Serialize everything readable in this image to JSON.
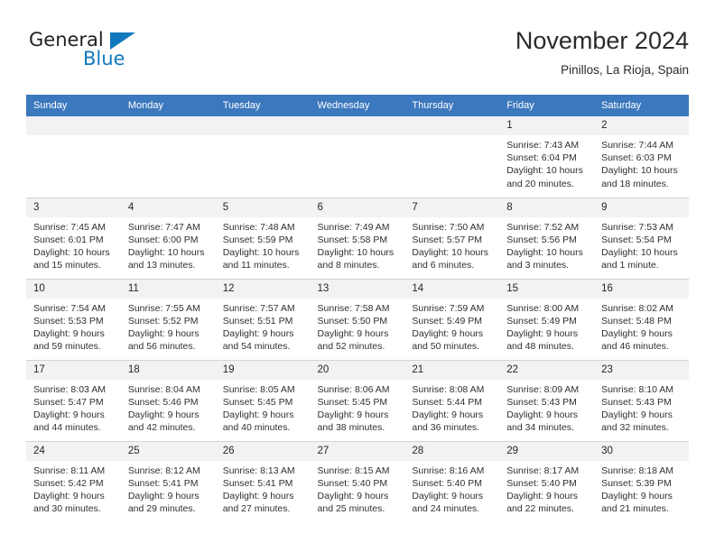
{
  "brand": {
    "name_top": "General",
    "name_bottom": "Blue",
    "triangle_color": "#1278be"
  },
  "header": {
    "month_title": "November 2024",
    "location": "Pinillos, La Rioja, Spain",
    "header_bg": "#3c78bd",
    "daynum_bg": "#f2f2f2"
  },
  "weekday_headers": [
    "Sunday",
    "Monday",
    "Tuesday",
    "Wednesday",
    "Thursday",
    "Friday",
    "Saturday"
  ],
  "labels": {
    "sunrise_prefix": "Sunrise:",
    "sunset_prefix": "Sunset:",
    "daylight_prefix": "Daylight:"
  },
  "weeks": [
    [
      {
        "day": "",
        "empty": true
      },
      {
        "day": "",
        "empty": true
      },
      {
        "day": "",
        "empty": true
      },
      {
        "day": "",
        "empty": true
      },
      {
        "day": "",
        "empty": true
      },
      {
        "day": "1",
        "sunrise": "Sunrise: 7:43 AM",
        "sunset": "Sunset: 6:04 PM",
        "daylight": "Daylight: 10 hours and 20 minutes."
      },
      {
        "day": "2",
        "sunrise": "Sunrise: 7:44 AM",
        "sunset": "Sunset: 6:03 PM",
        "daylight": "Daylight: 10 hours and 18 minutes."
      }
    ],
    [
      {
        "day": "3",
        "sunrise": "Sunrise: 7:45 AM",
        "sunset": "Sunset: 6:01 PM",
        "daylight": "Daylight: 10 hours and 15 minutes."
      },
      {
        "day": "4",
        "sunrise": "Sunrise: 7:47 AM",
        "sunset": "Sunset: 6:00 PM",
        "daylight": "Daylight: 10 hours and 13 minutes."
      },
      {
        "day": "5",
        "sunrise": "Sunrise: 7:48 AM",
        "sunset": "Sunset: 5:59 PM",
        "daylight": "Daylight: 10 hours and 11 minutes."
      },
      {
        "day": "6",
        "sunrise": "Sunrise: 7:49 AM",
        "sunset": "Sunset: 5:58 PM",
        "daylight": "Daylight: 10 hours and 8 minutes."
      },
      {
        "day": "7",
        "sunrise": "Sunrise: 7:50 AM",
        "sunset": "Sunset: 5:57 PM",
        "daylight": "Daylight: 10 hours and 6 minutes."
      },
      {
        "day": "8",
        "sunrise": "Sunrise: 7:52 AM",
        "sunset": "Sunset: 5:56 PM",
        "daylight": "Daylight: 10 hours and 3 minutes."
      },
      {
        "day": "9",
        "sunrise": "Sunrise: 7:53 AM",
        "sunset": "Sunset: 5:54 PM",
        "daylight": "Daylight: 10 hours and 1 minute."
      }
    ],
    [
      {
        "day": "10",
        "sunrise": "Sunrise: 7:54 AM",
        "sunset": "Sunset: 5:53 PM",
        "daylight": "Daylight: 9 hours and 59 minutes."
      },
      {
        "day": "11",
        "sunrise": "Sunrise: 7:55 AM",
        "sunset": "Sunset: 5:52 PM",
        "daylight": "Daylight: 9 hours and 56 minutes."
      },
      {
        "day": "12",
        "sunrise": "Sunrise: 7:57 AM",
        "sunset": "Sunset: 5:51 PM",
        "daylight": "Daylight: 9 hours and 54 minutes."
      },
      {
        "day": "13",
        "sunrise": "Sunrise: 7:58 AM",
        "sunset": "Sunset: 5:50 PM",
        "daylight": "Daylight: 9 hours and 52 minutes."
      },
      {
        "day": "14",
        "sunrise": "Sunrise: 7:59 AM",
        "sunset": "Sunset: 5:49 PM",
        "daylight": "Daylight: 9 hours and 50 minutes."
      },
      {
        "day": "15",
        "sunrise": "Sunrise: 8:00 AM",
        "sunset": "Sunset: 5:49 PM",
        "daylight": "Daylight: 9 hours and 48 minutes."
      },
      {
        "day": "16",
        "sunrise": "Sunrise: 8:02 AM",
        "sunset": "Sunset: 5:48 PM",
        "daylight": "Daylight: 9 hours and 46 minutes."
      }
    ],
    [
      {
        "day": "17",
        "sunrise": "Sunrise: 8:03 AM",
        "sunset": "Sunset: 5:47 PM",
        "daylight": "Daylight: 9 hours and 44 minutes."
      },
      {
        "day": "18",
        "sunrise": "Sunrise: 8:04 AM",
        "sunset": "Sunset: 5:46 PM",
        "daylight": "Daylight: 9 hours and 42 minutes."
      },
      {
        "day": "19",
        "sunrise": "Sunrise: 8:05 AM",
        "sunset": "Sunset: 5:45 PM",
        "daylight": "Daylight: 9 hours and 40 minutes."
      },
      {
        "day": "20",
        "sunrise": "Sunrise: 8:06 AM",
        "sunset": "Sunset: 5:45 PM",
        "daylight": "Daylight: 9 hours and 38 minutes."
      },
      {
        "day": "21",
        "sunrise": "Sunrise: 8:08 AM",
        "sunset": "Sunset: 5:44 PM",
        "daylight": "Daylight: 9 hours and 36 minutes."
      },
      {
        "day": "22",
        "sunrise": "Sunrise: 8:09 AM",
        "sunset": "Sunset: 5:43 PM",
        "daylight": "Daylight: 9 hours and 34 minutes."
      },
      {
        "day": "23",
        "sunrise": "Sunrise: 8:10 AM",
        "sunset": "Sunset: 5:43 PM",
        "daylight": "Daylight: 9 hours and 32 minutes."
      }
    ],
    [
      {
        "day": "24",
        "sunrise": "Sunrise: 8:11 AM",
        "sunset": "Sunset: 5:42 PM",
        "daylight": "Daylight: 9 hours and 30 minutes."
      },
      {
        "day": "25",
        "sunrise": "Sunrise: 8:12 AM",
        "sunset": "Sunset: 5:41 PM",
        "daylight": "Daylight: 9 hours and 29 minutes."
      },
      {
        "day": "26",
        "sunrise": "Sunrise: 8:13 AM",
        "sunset": "Sunset: 5:41 PM",
        "daylight": "Daylight: 9 hours and 27 minutes."
      },
      {
        "day": "27",
        "sunrise": "Sunrise: 8:15 AM",
        "sunset": "Sunset: 5:40 PM",
        "daylight": "Daylight: 9 hours and 25 minutes."
      },
      {
        "day": "28",
        "sunrise": "Sunrise: 8:16 AM",
        "sunset": "Sunset: 5:40 PM",
        "daylight": "Daylight: 9 hours and 24 minutes."
      },
      {
        "day": "29",
        "sunrise": "Sunrise: 8:17 AM",
        "sunset": "Sunset: 5:40 PM",
        "daylight": "Daylight: 9 hours and 22 minutes."
      },
      {
        "day": "30",
        "sunrise": "Sunrise: 8:18 AM",
        "sunset": "Sunset: 5:39 PM",
        "daylight": "Daylight: 9 hours and 21 minutes."
      }
    ]
  ]
}
